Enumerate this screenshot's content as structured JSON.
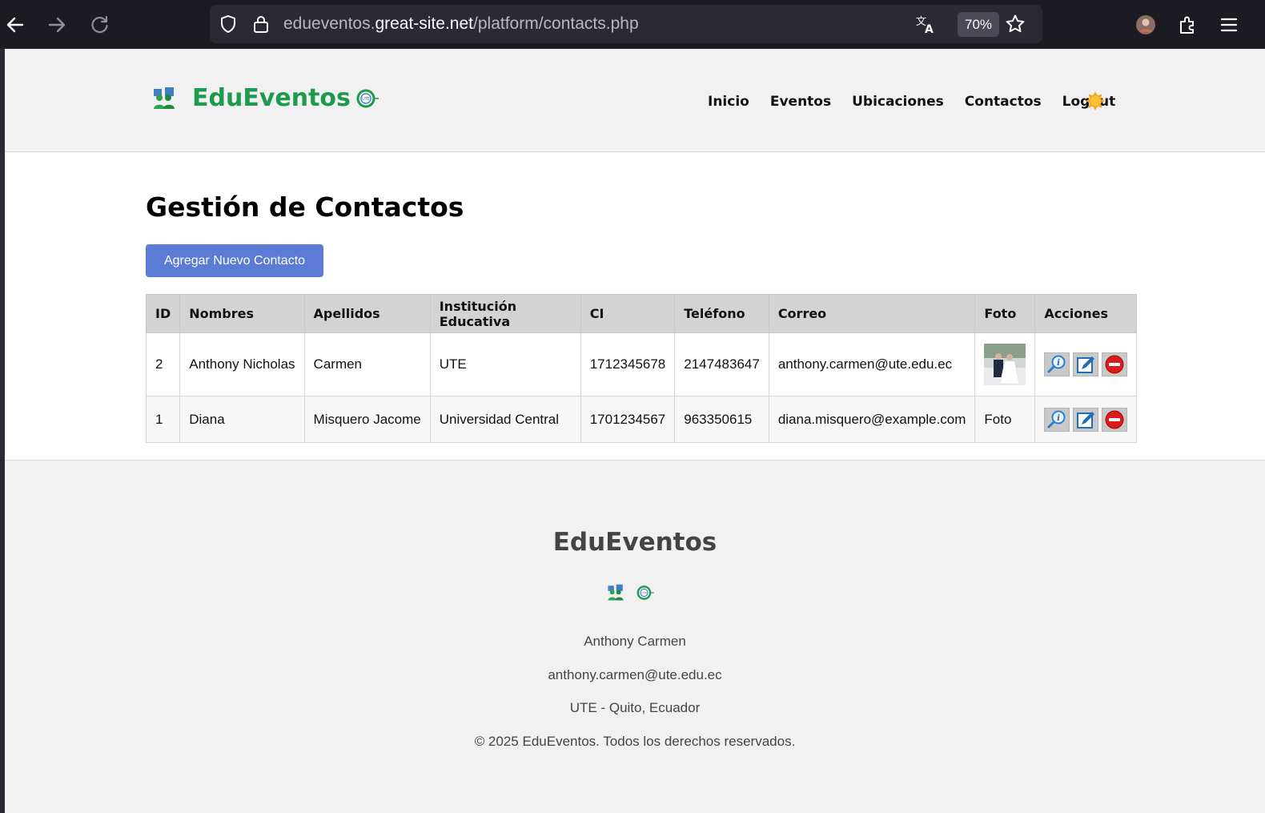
{
  "browser": {
    "url_prefix": "edueventos.",
    "url_host": "great-site.net",
    "url_path": "/platform/contacts.php",
    "zoom": "70%"
  },
  "header": {
    "brand": "EduEventos",
    "nav": [
      "Inicio",
      "Eventos",
      "Ubicaciones",
      "Contactos",
      "Logout"
    ]
  },
  "main": {
    "title": "Gestión de Contactos",
    "add_button": "Agregar Nuevo Contacto",
    "table": {
      "headers": [
        "ID",
        "Nombres",
        "Apellidos",
        "Institución Educativa",
        "CI",
        "Teléfono",
        "Correo",
        "Foto",
        "Acciones"
      ],
      "rows": [
        {
          "id": "2",
          "nombres": "Anthony Nicholas",
          "apellidos": "Carmen",
          "institucion": "UTE",
          "ci": "1712345678",
          "telefono": "2147483647",
          "correo": "anthony.carmen@ute.edu.ec",
          "foto": ""
        },
        {
          "id": "1",
          "nombres": "Diana",
          "apellidos": "Misquero Jacome",
          "institucion": "Universidad Central",
          "ci": "1701234567",
          "telefono": "963350615",
          "correo": "diana.misquero@example.com",
          "foto": "Foto"
        }
      ]
    }
  },
  "footer": {
    "title": "EduEventos",
    "name": "Anthony Carmen",
    "email": "anthony.carmen@ute.edu.ec",
    "location": "UTE - Quito, Ecuador",
    "copyright": "© 2025 EduEventos. Todos los derechos reservados."
  },
  "colors": {
    "brand_green": "#1e9a4e",
    "button_blue": "#5b7bd5",
    "header_bg": "#d3d3d3",
    "delete_red": "#d81b1b"
  },
  "icons": [
    "back-arrow-icon",
    "forward-arrow-icon",
    "reload-icon",
    "shield-icon",
    "lock-icon",
    "translate-icon",
    "star-icon",
    "profile-avatar-icon",
    "extensions-icon",
    "menu-icon",
    "logo-people-icon",
    "ute-logo-icon",
    "sun-icon",
    "view-details-icon",
    "edit-icon",
    "delete-icon"
  ]
}
